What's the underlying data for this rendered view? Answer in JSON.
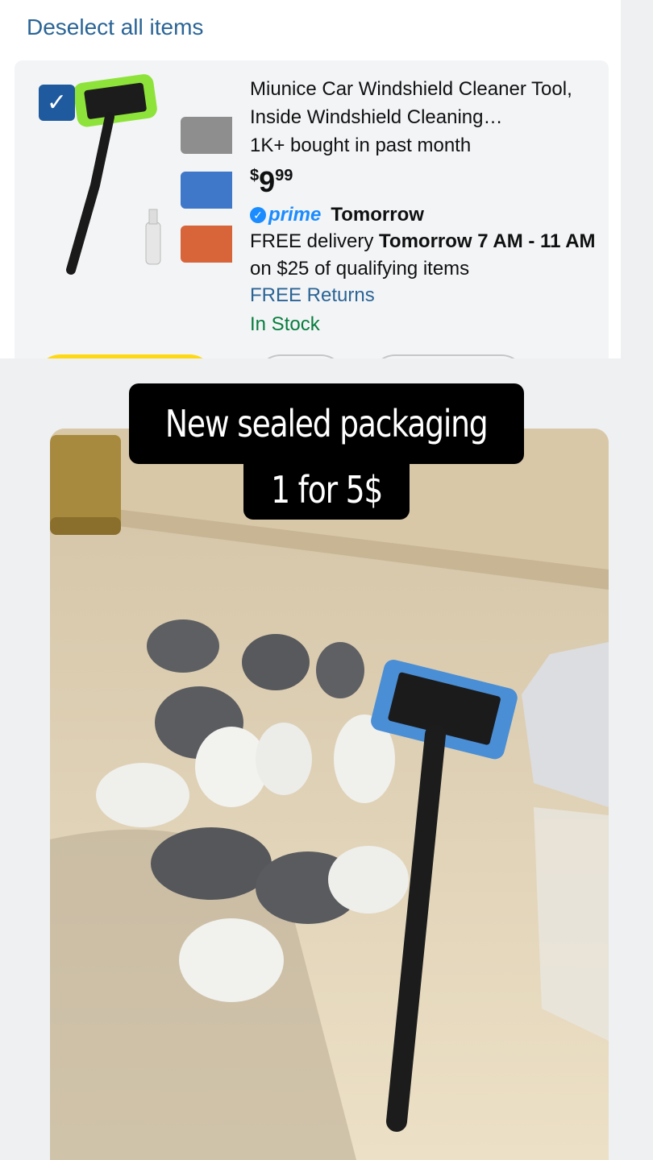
{
  "cart": {
    "deselect_label": "Deselect all items",
    "item": {
      "title": "Miunice Car Windshield Cleaner Tool, Inside Windshield Cleaning…",
      "bought": "1K+ bought in past month",
      "price_symbol": "$",
      "price_whole": "9",
      "price_fraction": "99",
      "prime_label": "prime",
      "prime_day": "Tomorrow",
      "delivery_prefix": "FREE delivery",
      "delivery_window": "Tomorrow 7 AM - 11 AM",
      "delivery_suffix": "on $25 of qualifying items",
      "returns": "FREE Returns",
      "stock": "In Stock",
      "checked": true,
      "checkbox_icon": "checkmark-icon"
    }
  },
  "overlay": {
    "line1": "New sealed packaging",
    "line2": "1 for 5$"
  },
  "colors": {
    "link": "#2a6496",
    "prime": "#1a8cff",
    "stock": "#067d3d",
    "add_button": "#ffd814"
  }
}
